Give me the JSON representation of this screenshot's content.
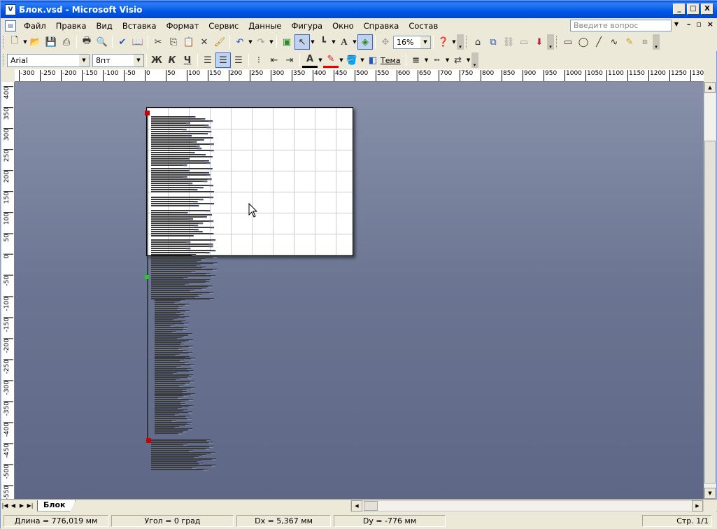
{
  "window": {
    "title": "Блок.vsd - Microsoft Visio",
    "min": "_",
    "max": "□",
    "close": "X"
  },
  "menu": {
    "items": [
      "Файл",
      "Правка",
      "Вид",
      "Вставка",
      "Формат",
      "Сервис",
      "Данные",
      "Фигура",
      "Окно",
      "Справка",
      "Состав"
    ],
    "help_placeholder": "Введите вопрос",
    "mdi_min": "–",
    "mdi_max": "▫",
    "mdi_close": "×"
  },
  "toolbar": {
    "zoom": "16%",
    "theme_label": "Тема"
  },
  "format_toolbar": {
    "font": "Arial",
    "size": "8пт",
    "bold": "Ж",
    "italic": "К",
    "underline": "Ч"
  },
  "ruler": {
    "top_labels": [
      "-300",
      "-250",
      "-200",
      "-150",
      "-100",
      "-50",
      "0",
      "50",
      "100",
      "150",
      "200",
      "250",
      "300",
      "350",
      "400",
      "450",
      "500",
      "550",
      "600",
      "650",
      "700",
      "750",
      "800",
      "850",
      "900",
      "950",
      "1000",
      "1050",
      "1100",
      "1150",
      "1200",
      "1250",
      "1300"
    ],
    "left_labels": [
      "400",
      "350",
      "300",
      "250",
      "200",
      "150",
      "100",
      "50",
      "0",
      "-50",
      "-100",
      "-150",
      "-200",
      "-250",
      "-300",
      "-350",
      "-400",
      "-450",
      "-500",
      "-550"
    ]
  },
  "page_tabs": {
    "active": "Блок"
  },
  "status": {
    "length": "Длина = 776,019 мм",
    "angle": "Угол = 0 град",
    "dx": "Dx = 5,367 мм",
    "dy": "Dy = -776 мм",
    "page": "Стр. 1/1"
  }
}
